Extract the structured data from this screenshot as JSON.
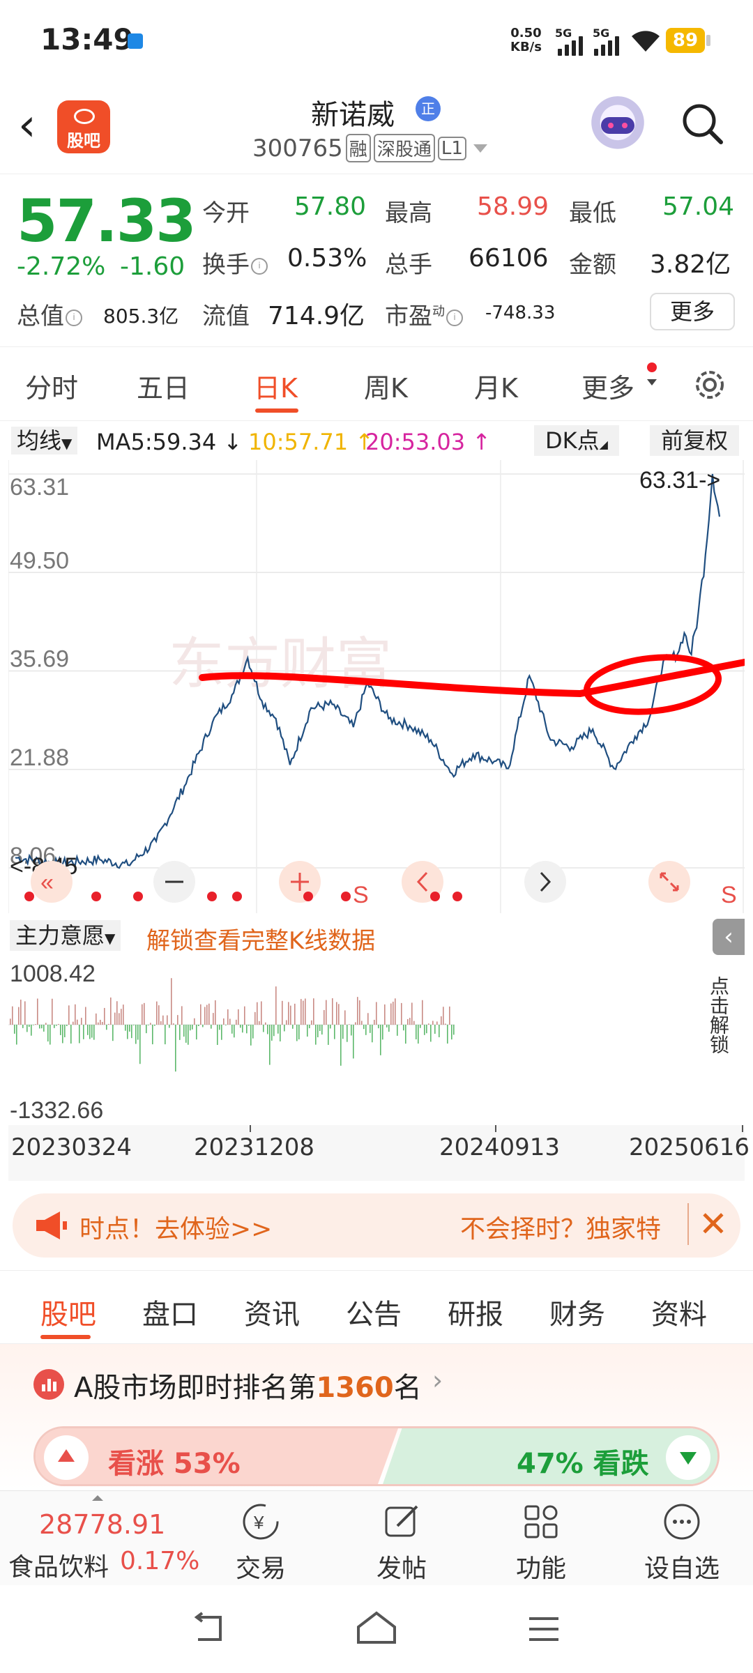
{
  "status": {
    "time": "13:49",
    "net_speed": "0.50",
    "net_unit": "KB/s",
    "sig1": "5G",
    "sig2": "5G",
    "battery": "89"
  },
  "header": {
    "logo_text": "股吧",
    "stock_name": "新诺威",
    "badge": "正",
    "stock_code": "300765",
    "tags": [
      "融",
      "深股通",
      "L1"
    ]
  },
  "quote": {
    "price": "57.33",
    "change_pct": "-2.72%",
    "change": "-1.60",
    "market_cap_label": "总值",
    "market_cap": "805.3亿",
    "open_label": "今开",
    "open": "57.80",
    "high_label": "最高",
    "high": "58.99",
    "low_label": "最低",
    "low": "57.04",
    "turnover_label": "换手",
    "turnover": "0.53%",
    "volume_label": "总手",
    "volume": "66106",
    "amount_label": "金额",
    "amount": "3.82亿",
    "float_cap_label": "流值",
    "float_cap": "714.9亿",
    "pe_label": "市盈",
    "pe_sup": "动",
    "pe": "-748.33",
    "more": "更多"
  },
  "periods": {
    "tabs": [
      "分时",
      "五日",
      "日K",
      "周K",
      "月K",
      "更多"
    ],
    "active": "日K"
  },
  "ma_bar": {
    "selector": "均线",
    "ma5": "MA5:59.34 ↓",
    "ma10": "10:57.71 ↑",
    "ma20": "20:53.03 ↑",
    "dk": "DK点",
    "adjust": "前复权",
    "ma10_color": "#f0b400",
    "ma20_color": "#d6249f"
  },
  "kchart": {
    "y_ticks": [
      "63.31",
      "49.50",
      "35.69",
      "21.88",
      "8.06"
    ],
    "max_label": "63.31->",
    "min_label": "<-8.45",
    "watermark": "东方财富",
    "markers": [
      "S",
      "S"
    ],
    "line_color": "#1f4e80",
    "annotation_color": "#ff0000"
  },
  "chart_data": {
    "type": "line",
    "title": "",
    "xlabel": "",
    "ylabel": "",
    "ylim": [
      8.06,
      63.31
    ],
    "x_ticks": [
      "20230324",
      "20231208",
      "20240913",
      "20250616"
    ],
    "x": [
      0,
      0.06,
      0.12,
      0.16,
      0.2,
      0.24,
      0.28,
      0.31,
      0.33,
      0.35,
      0.37,
      0.39,
      0.42,
      0.45,
      0.48,
      0.5,
      0.53,
      0.56,
      0.59,
      0.62,
      0.65,
      0.68,
      0.7,
      0.73,
      0.76,
      0.79,
      0.82,
      0.85,
      0.88,
      0.9,
      0.92,
      0.94,
      0.95,
      0.96,
      0.97,
      0.98,
      0.99,
      1.0
    ],
    "values": [
      9.5,
      8.7,
      9.2,
      8.45,
      11.8,
      19.5,
      28.5,
      32.6,
      37.5,
      31.5,
      29.0,
      22.5,
      30.5,
      31.0,
      27.8,
      34.0,
      29.0,
      28.0,
      26.0,
      21.3,
      24.0,
      23.0,
      22.0,
      35.0,
      26.0,
      25.0,
      27.5,
      22.0,
      26.5,
      29.0,
      37.0,
      38.0,
      41.0,
      38.0,
      44.0,
      52.0,
      63.31,
      57.33
    ]
  },
  "indicator": {
    "selector": "主力意愿",
    "unlock_text": "解锁查看完整K线数据",
    "side_text": "点击解锁",
    "y_max": "1008.42",
    "y_min": "-1332.66"
  },
  "ad": {
    "left": "时点！去体验>>",
    "right": "不会择时？独家特"
  },
  "tabs2": {
    "tabs": [
      "股吧",
      "盘口",
      "资讯",
      "公告",
      "研报",
      "财务",
      "资料"
    ],
    "active": "股吧"
  },
  "rank": {
    "prefix": "A股市场即时排名第",
    "number": "1360",
    "suffix": "名"
  },
  "vote": {
    "up": "看涨 53%",
    "down": "47% 看跌",
    "up_pct": 53,
    "down_pct": 47
  },
  "bottom_nav": {
    "index_value": "28778.91",
    "sector": "食品饮料",
    "sector_pct": "0.17%",
    "buttons": [
      "交易",
      "发帖",
      "功能",
      "设自选"
    ]
  }
}
